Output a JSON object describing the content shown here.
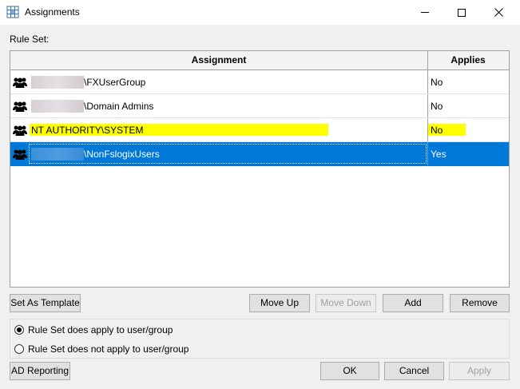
{
  "window": {
    "title": "Assignments"
  },
  "labels": {
    "rule_set": "Rule Set:"
  },
  "grid": {
    "columns": [
      "Assignment",
      "Applies"
    ],
    "rows": [
      {
        "assignment": "\\FXUserGroup",
        "applies": "No"
      },
      {
        "assignment": "\\Domain Admins",
        "applies": "No"
      },
      {
        "assignment": "NT AUTHORITY\\SYSTEM",
        "applies": "No"
      },
      {
        "assignment": "\\NonFslogixUsers",
        "applies": "Yes"
      }
    ]
  },
  "buttons": {
    "set_as_template": "Set As Template",
    "move_up": "Move Up",
    "move_down": "Move Down",
    "add": "Add",
    "remove": "Remove",
    "ad_reporting": "AD Reporting",
    "ok": "OK",
    "cancel": "Cancel",
    "apply": "Apply"
  },
  "radios": {
    "applies": "Rule Set does apply to user/group",
    "not_applies": "Rule Set does not apply to user/group",
    "selected": "applies"
  },
  "colors": {
    "selection": "#0078d7",
    "highlight": "#ffff00"
  },
  "icons": {
    "app": "grid-globe-icon",
    "row": "users-group-icon"
  }
}
